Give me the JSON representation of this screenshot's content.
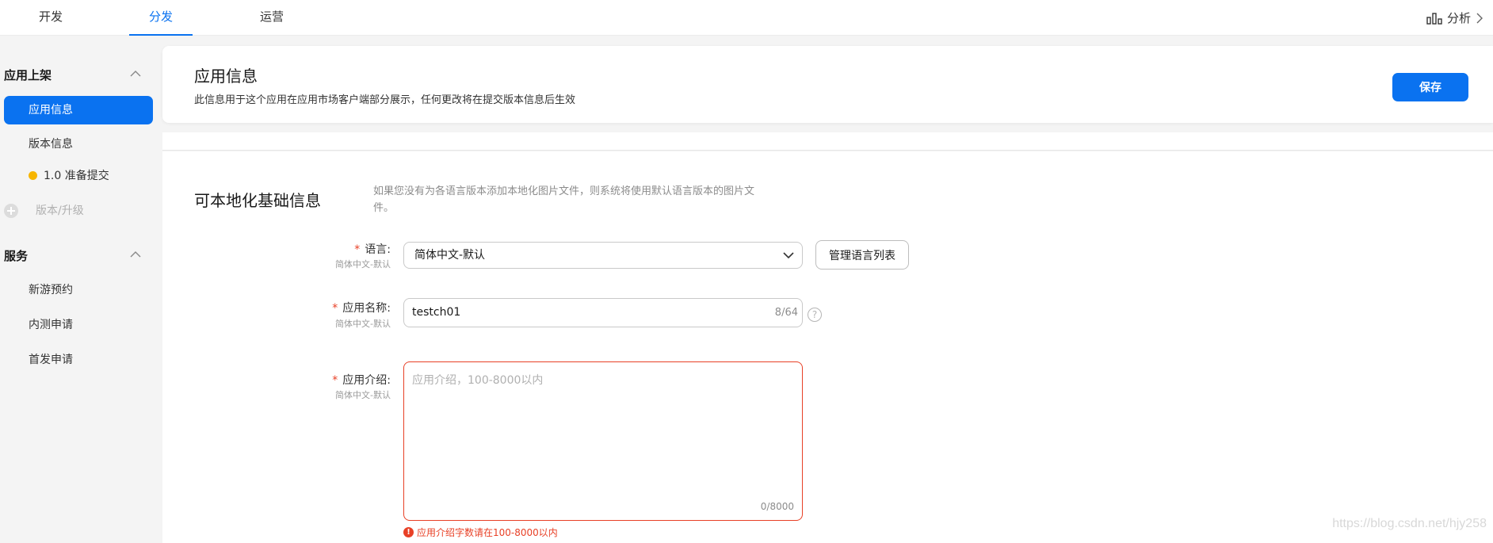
{
  "nav": {
    "tabs": [
      {
        "label": "开发"
      },
      {
        "label": "分发",
        "active": true
      },
      {
        "label": "运营"
      }
    ],
    "analysis_label": "分析"
  },
  "sidebar": {
    "groups": [
      {
        "title": "应用上架",
        "items": [
          {
            "label": "应用信息",
            "active": true
          },
          {
            "label": "版本信息"
          },
          {
            "label": "1.0 准备提交",
            "status_color": "#f7b500"
          },
          {
            "label": "版本/升级",
            "disabled": true
          }
        ]
      },
      {
        "title": "服务",
        "items": [
          {
            "label": "新游预约"
          },
          {
            "label": "内测申请"
          },
          {
            "label": "首发申请"
          }
        ]
      }
    ]
  },
  "header": {
    "title": "应用信息",
    "description": "此信息用于这个应用在应用市场客户端部分展示，任何更改将在提交版本信息后生效",
    "save_label": "保存"
  },
  "section": {
    "title": "可本地化基础信息",
    "note": "如果您没有为各语言版本添加本地化图片文件，则系统将使用默认语言版本的图片文件。"
  },
  "form": {
    "required_mark": "*",
    "language": {
      "label": "语言:",
      "sublabel": "简体中文-默认",
      "value": "简体中文-默认",
      "manage_label": "管理语言列表"
    },
    "app_name": {
      "label": "应用名称:",
      "sublabel": "简体中文-默认",
      "value": "testch01",
      "counter": "8/64",
      "help": "?"
    },
    "app_intro": {
      "label": "应用介绍:",
      "sublabel": "简体中文-默认",
      "placeholder": "应用介绍，100-8000以内",
      "counter": "0/8000",
      "error": "应用介绍字数请在100-8000以内",
      "error_icon": "!"
    }
  },
  "watermark": "https://blog.csdn.net/hjy258",
  "colors": {
    "accent": "#0a72f0",
    "error": "#e84026",
    "status": "#f7b500"
  }
}
